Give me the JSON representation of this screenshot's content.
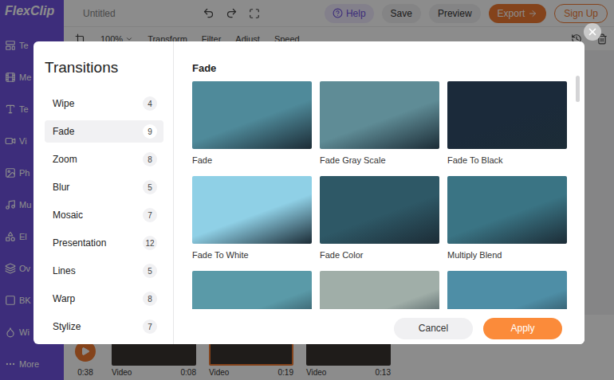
{
  "editor": {
    "logo": "FlexClip",
    "title": "Untitled",
    "help": "Help",
    "actions": [
      {
        "label": "Save",
        "kind": "plain"
      },
      {
        "label": "Preview",
        "kind": "plain"
      },
      {
        "label": "Export",
        "kind": "primary"
      },
      {
        "label": "Sign Up",
        "kind": "outline"
      }
    ],
    "sidebar": [
      {
        "label": "Te"
      },
      {
        "label": "Me"
      },
      {
        "label": "Te"
      },
      {
        "label": "Vi"
      },
      {
        "label": "Ph"
      },
      {
        "label": "Mu"
      },
      {
        "label": "El"
      },
      {
        "label": "Ov"
      },
      {
        "label": "BK"
      },
      {
        "label": "Wi"
      },
      {
        "label": "More"
      }
    ],
    "toolbar": {
      "zoom": "100%",
      "tools": [
        "Transform",
        "Filter",
        "Adjust",
        "Speed"
      ]
    },
    "timeline": {
      "duration": "0:38",
      "clips": [
        {
          "label": "Video",
          "time": "0:08",
          "selected": false
        },
        {
          "label": "Video",
          "time": "0:19",
          "selected": true
        },
        {
          "label": "Video",
          "time": "0:13",
          "selected": false
        }
      ]
    }
  },
  "dialog": {
    "title": "Transitions",
    "categories": [
      {
        "label": "Wipe",
        "count": "4",
        "selected": false
      },
      {
        "label": "Fade",
        "count": "9",
        "selected": true
      },
      {
        "label": "Zoom",
        "count": "8",
        "selected": false
      },
      {
        "label": "Blur",
        "count": "5",
        "selected": false
      },
      {
        "label": "Mosaic",
        "count": "7",
        "selected": false
      },
      {
        "label": "Presentation",
        "count": "12",
        "selected": false
      },
      {
        "label": "Lines",
        "count": "5",
        "selected": false
      },
      {
        "label": "Warp",
        "count": "8",
        "selected": false
      },
      {
        "label": "Stylize",
        "count": "7",
        "selected": false
      }
    ],
    "section": "Fade",
    "items": [
      {
        "label": "Fade",
        "color": "#4f8a9a"
      },
      {
        "label": "Fade Gray Scale",
        "color": "#5f8c96"
      },
      {
        "label": "Fade To Black",
        "color": "#1b2a3a"
      },
      {
        "label": "Fade To White",
        "color": "#8fd0e6"
      },
      {
        "label": "Fade Color",
        "color": "#2e5866"
      },
      {
        "label": "Multiply Blend",
        "color": "#3a7484"
      },
      {
        "label": "",
        "color": "#5a9aa8"
      },
      {
        "label": "",
        "color": "#a0aea8"
      },
      {
        "label": "",
        "color": "#4e8ea6"
      }
    ],
    "buttons": [
      {
        "label": "Cancel",
        "kind": "secondary"
      },
      {
        "label": "Apply",
        "kind": "primary"
      }
    ]
  }
}
